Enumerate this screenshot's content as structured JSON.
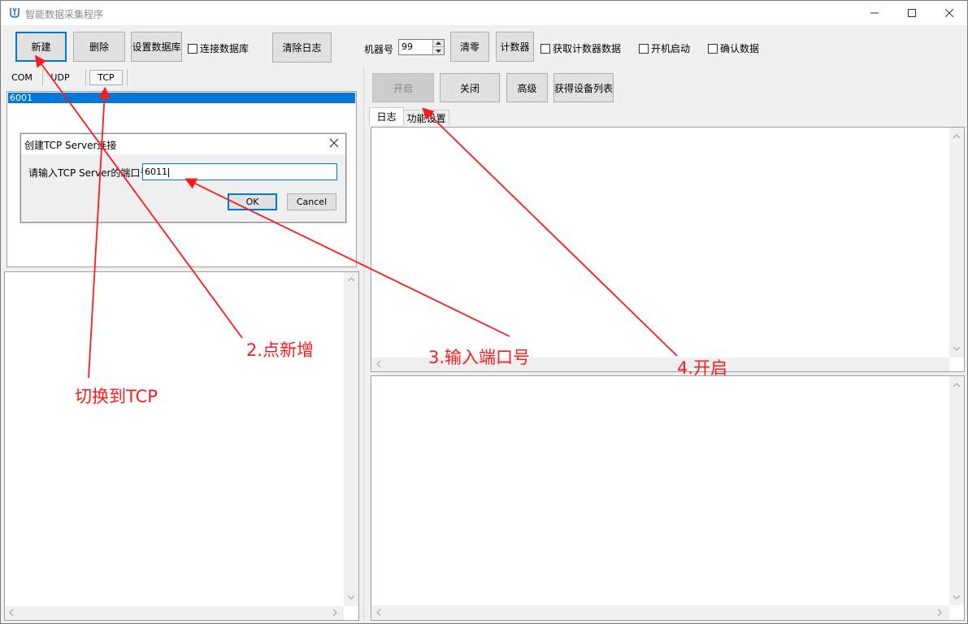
{
  "window": {
    "title": "智能数据采集程序"
  },
  "toolbar": {
    "new_label": "新建",
    "delete_label": "删除",
    "set_db_label": "设置数据库",
    "connect_db_label": "连接数据库",
    "clear_log_label": "清除日志",
    "machine_label": "机器号",
    "machine_value": "99",
    "reset_label": "清零",
    "counter_label": "计数器",
    "get_counter_label": "获取计数器数据",
    "autostart_label": "开机启动",
    "confirm_label": "确认数据"
  },
  "left_tabs": [
    "COM",
    "UDP",
    "TCP"
  ],
  "conn_list": {
    "selected": "6001"
  },
  "dialog": {
    "title": "创建TCP Server连接",
    "prompt": "请输入TCP Server的端口号",
    "value": "6011",
    "ok": "OK",
    "cancel": "Cancel"
  },
  "right_toolbar": {
    "open_label": "开启",
    "close_label": "关闭",
    "advanced_label": "高级",
    "device_list_label": "获得设备列表"
  },
  "right_tabs": [
    "日志",
    "功能设置"
  ],
  "annotations": {
    "switch_tcp": "切换到TCP",
    "click_new": "2.点新增",
    "input_port": "3.输入端口号",
    "open": "4.开启"
  },
  "colors": {
    "accent": "#0078d7",
    "annotation": "#ff1a1a"
  }
}
